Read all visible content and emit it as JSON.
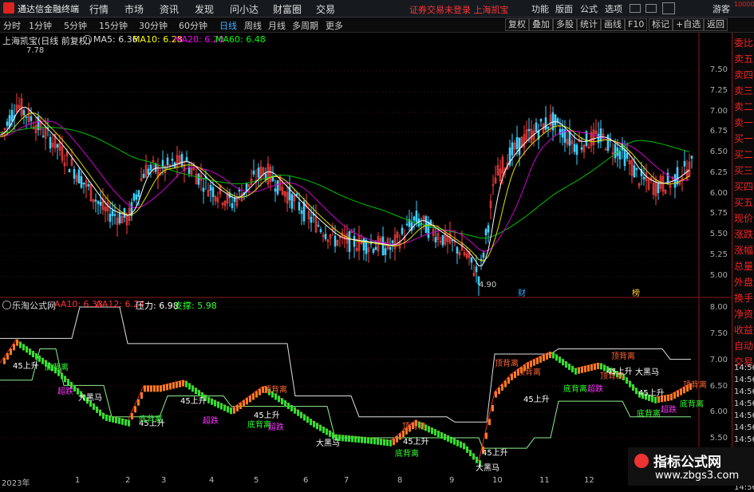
{
  "app": {
    "title": "通达信金融终端",
    "menu": [
      "行情",
      "市场",
      "资讯",
      "发现",
      "问小达",
      "财富圈",
      "交易"
    ],
    "warning": "证券交易未登录 上海凯宝",
    "right_menu": [
      "功能",
      "版面",
      "公式",
      "选项"
    ],
    "guest": "游客"
  },
  "toolbar": {
    "periods": [
      "分时",
      "1分钟",
      "5分钟",
      "15分钟",
      "30分钟",
      "60分钟",
      "日线",
      "周线",
      "月线",
      "多周期",
      "更多"
    ],
    "active_period": "日线",
    "buttons": [
      "复权",
      "叠加",
      "多股",
      "统计",
      "画线",
      "F10",
      "标记",
      "+自选",
      "返回"
    ]
  },
  "sidebar": {
    "badge": "10000",
    "items": [
      "委比",
      "卖五",
      "卖四",
      "卖三",
      "卖二",
      "卖一",
      "买一",
      "买二",
      "买三",
      "买四",
      "买五",
      "现价",
      "涨跌",
      "涨幅",
      "总量",
      "外盘",
      "换手",
      "净资",
      "收益",
      "自动",
      "交易"
    ]
  },
  "main_chart": {
    "stock": "上海凯宝(日线 前复权)",
    "ma_labels": [
      {
        "text": "MA5: 6.36",
        "color": "#ffffff"
      },
      {
        "text": "MA10: 6.28",
        "color": "#ffff00"
      },
      {
        "text": "MA20: 6.20",
        "color": "#ff00ff"
      },
      {
        "text": "MA60: 6.48",
        "color": "#00ff00"
      }
    ],
    "high_label": "7.78",
    "low_label": "4.90",
    "axis": [
      "7.50",
      "7.25",
      "7.00",
      "6.75",
      "6.50",
      "6.25",
      "6.00",
      "5.75",
      "5.50",
      "5.25",
      "5.00"
    ],
    "markers": [
      "财",
      "榜"
    ]
  },
  "indicator": {
    "name": "乐淘公式网",
    "vals": [
      {
        "text": "AA10: 6.33",
        "color": "#ff3333"
      },
      {
        "text": "AA12: 6.24",
        "color": "#ff3333"
      },
      {
        "text": "压力: 6.98",
        "color": "#ffffff"
      },
      {
        "text": "支撑: 5.98",
        "color": "#33ff33"
      }
    ],
    "axis": [
      "8.00",
      "7.50",
      "7.00",
      "6.50",
      "6.00",
      "5.50"
    ],
    "right_times": [
      "14:56",
      "14:56",
      "14:56",
      "14:56",
      "14:56",
      "14:56",
      "14:56",
      "14:56",
      "14:56",
      "14:56",
      "14:56"
    ],
    "labels": [
      {
        "text": "45上升",
        "color": "#ffffff"
      },
      {
        "text": "底背离",
        "color": "#33ff33"
      },
      {
        "text": "超跌",
        "color": "#ff33ff"
      },
      {
        "text": "大黑马",
        "color": "#ffffff"
      },
      {
        "text": "45上升",
        "color": "#ffffff"
      },
      {
        "text": "底背离",
        "color": "#33ff33"
      },
      {
        "text": "45上升",
        "color": "#ffffff"
      },
      {
        "text": "超跌",
        "color": "#ff33ff"
      },
      {
        "text": "45上升",
        "color": "#ffffff"
      },
      {
        "text": "底背离",
        "color": "#33ff33"
      },
      {
        "text": "超跌",
        "color": "#ff33ff"
      },
      {
        "text": "顶背离",
        "color": "#ff6633"
      },
      {
        "text": "大黑马",
        "color": "#ffffff"
      },
      {
        "text": "顶背离",
        "color": "#ff6633"
      },
      {
        "text": "45上升",
        "color": "#ffffff"
      },
      {
        "text": "底背离",
        "color": "#33ff33"
      },
      {
        "text": "45上升",
        "color": "#ffffff"
      },
      {
        "text": "大黑马",
        "color": "#ffffff"
      },
      {
        "text": "顶背离",
        "color": "#ff6633"
      },
      {
        "text": "顶背离",
        "color": "#ff6633"
      },
      {
        "text": "45上升",
        "color": "#ffffff"
      },
      {
        "text": "底背离",
        "color": "#33ff33"
      },
      {
        "text": "超跌",
        "color": "#ff33ff"
      },
      {
        "text": "顶背离",
        "color": "#ff6633"
      },
      {
        "text": "顶背离",
        "color": "#ff6633"
      },
      {
        "text": "45上升",
        "color": "#ffffff"
      },
      {
        "text": "大黑马",
        "color": "#ffffff"
      },
      {
        "text": "45上升",
        "color": "#ffffff"
      },
      {
        "text": "底背离",
        "color": "#33ff33"
      },
      {
        "text": "超跌",
        "color": "#ff33ff"
      },
      {
        "text": "底背离",
        "color": "#33ff33"
      },
      {
        "text": "顶背离",
        "color": "#ff6633"
      }
    ]
  },
  "x_axis": [
    "2023年",
    "1",
    "2",
    "3",
    "4",
    "5",
    "6",
    "7",
    "8",
    "9",
    "10",
    "11",
    "12"
  ],
  "watermark": {
    "line1": "指标公式网",
    "line2": "www.zbgs3.com"
  }
}
